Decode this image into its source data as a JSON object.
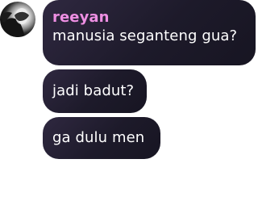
{
  "chat": {
    "avatar_icon": "profile-photo-avatar",
    "username": "reeyan",
    "messages": [
      {
        "text": "manusia seganteng gua?"
      },
      {
        "text": "jadi badut?"
      },
      {
        "text": "ga dulu men"
      }
    ]
  },
  "colors": {
    "bubble": "#1f1b2b",
    "username": "#ee8fe3",
    "message_text": "#ffffff",
    "background": "#ffffff"
  }
}
